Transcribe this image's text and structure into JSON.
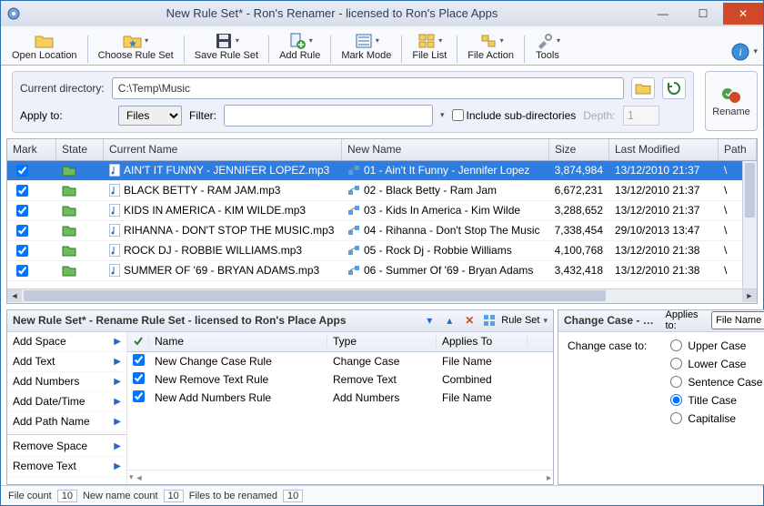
{
  "window": {
    "title": "New Rule Set* - Ron's Renamer - licensed to Ron's Place Apps"
  },
  "toolbar": {
    "open_location": "Open Location",
    "choose_rule_set": "Choose Rule Set",
    "save_rule_set": "Save Rule Set",
    "add_rule": "Add Rule",
    "mark_mode": "Mark Mode",
    "file_list": "File List",
    "file_action": "File Action",
    "tools": "Tools"
  },
  "dirbar": {
    "current_directory_label": "Current directory:",
    "current_directory_value": "C:\\Temp\\Music",
    "apply_to_label": "Apply to:",
    "apply_to_value": "Files",
    "filter_label": "Filter:",
    "filter_value": "",
    "include_subdirs_label": "Include sub-directories",
    "include_subdirs_checked": false,
    "depth_label": "Depth:",
    "depth_value": "1",
    "rename_button": "Rename"
  },
  "grid": {
    "headers": {
      "mark": "Mark",
      "state": "State",
      "current_name": "Current Name",
      "new_name": "New Name",
      "size": "Size",
      "last_modified": "Last Modified",
      "path": "Path"
    },
    "rows": [
      {
        "mark": true,
        "current": "AIN'T IT FUNNY - JENNIFER LOPEZ.mp3",
        "new": "01 - Ain't It Funny - Jennifer Lopez",
        "size": "3,874,984",
        "mod": "13/12/2010 21:37",
        "path": "\\",
        "selected": true
      },
      {
        "mark": true,
        "current": "BLACK BETTY - RAM JAM.mp3",
        "new": "02 - Black Betty - Ram Jam",
        "size": "6,672,231",
        "mod": "13/12/2010 21:37",
        "path": "\\"
      },
      {
        "mark": true,
        "current": "KIDS IN AMERICA - KIM WILDE.mp3",
        "new": "03 - Kids In America - Kim Wilde",
        "size": "3,288,652",
        "mod": "13/12/2010 21:37",
        "path": "\\"
      },
      {
        "mark": true,
        "current": "RIHANNA - DON'T STOP THE MUSIC.mp3",
        "new": "04 - Rihanna - Don't Stop The Music",
        "size": "7,338,454",
        "mod": "29/10/2013 13:47",
        "path": "\\"
      },
      {
        "mark": true,
        "current": "ROCK DJ - ROBBIE WILLIAMS.mp3",
        "new": "05 - Rock Dj - Robbie Williams",
        "size": "4,100,768",
        "mod": "13/12/2010 21:38",
        "path": "\\"
      },
      {
        "mark": true,
        "current": "SUMMER OF '69 - BRYAN ADAMS.mp3",
        "new": "06 - Summer Of '69 - Bryan Adams",
        "size": "3,432,418",
        "mod": "13/12/2010 21:38",
        "path": "\\"
      }
    ]
  },
  "ruleset": {
    "panel_title": "New Rule Set* - Rename Rule Set - licensed to Ron's Place Apps",
    "ruleset_button": "Rule Set",
    "actions": [
      "Add Space",
      "Add Text",
      "Add Numbers",
      "Add Date/Time",
      "Add Path Name",
      "Remove Space",
      "Remove Text"
    ],
    "columns": {
      "name": "Name",
      "type": "Type",
      "applies": "Applies To"
    },
    "rules": [
      {
        "on": true,
        "name": "New Change Case Rule",
        "type": "Change Case",
        "applies": "File Name"
      },
      {
        "on": true,
        "name": "New Remove Text Rule",
        "type": "Remove Text",
        "applies": "Combined"
      },
      {
        "on": true,
        "name": "New Add Numbers Rule",
        "type": "Add Numbers",
        "applies": "File Name"
      }
    ]
  },
  "changecase": {
    "panel_title": "Change Case - Ne…",
    "applies_to_label": "Applies to:",
    "applies_to_value": "File Name",
    "change_case_to_label": "Change case to:",
    "options": [
      "Upper Case",
      "Lower Case",
      "Sentence Case",
      "Title Case",
      "Capitalise"
    ],
    "selected": "Title Case"
  },
  "status": {
    "file_count_label": "File count",
    "file_count": "10",
    "new_name_count_label": "New name count",
    "new_name_count": "10",
    "to_rename_label": "Files to be renamed",
    "to_rename": "10"
  }
}
